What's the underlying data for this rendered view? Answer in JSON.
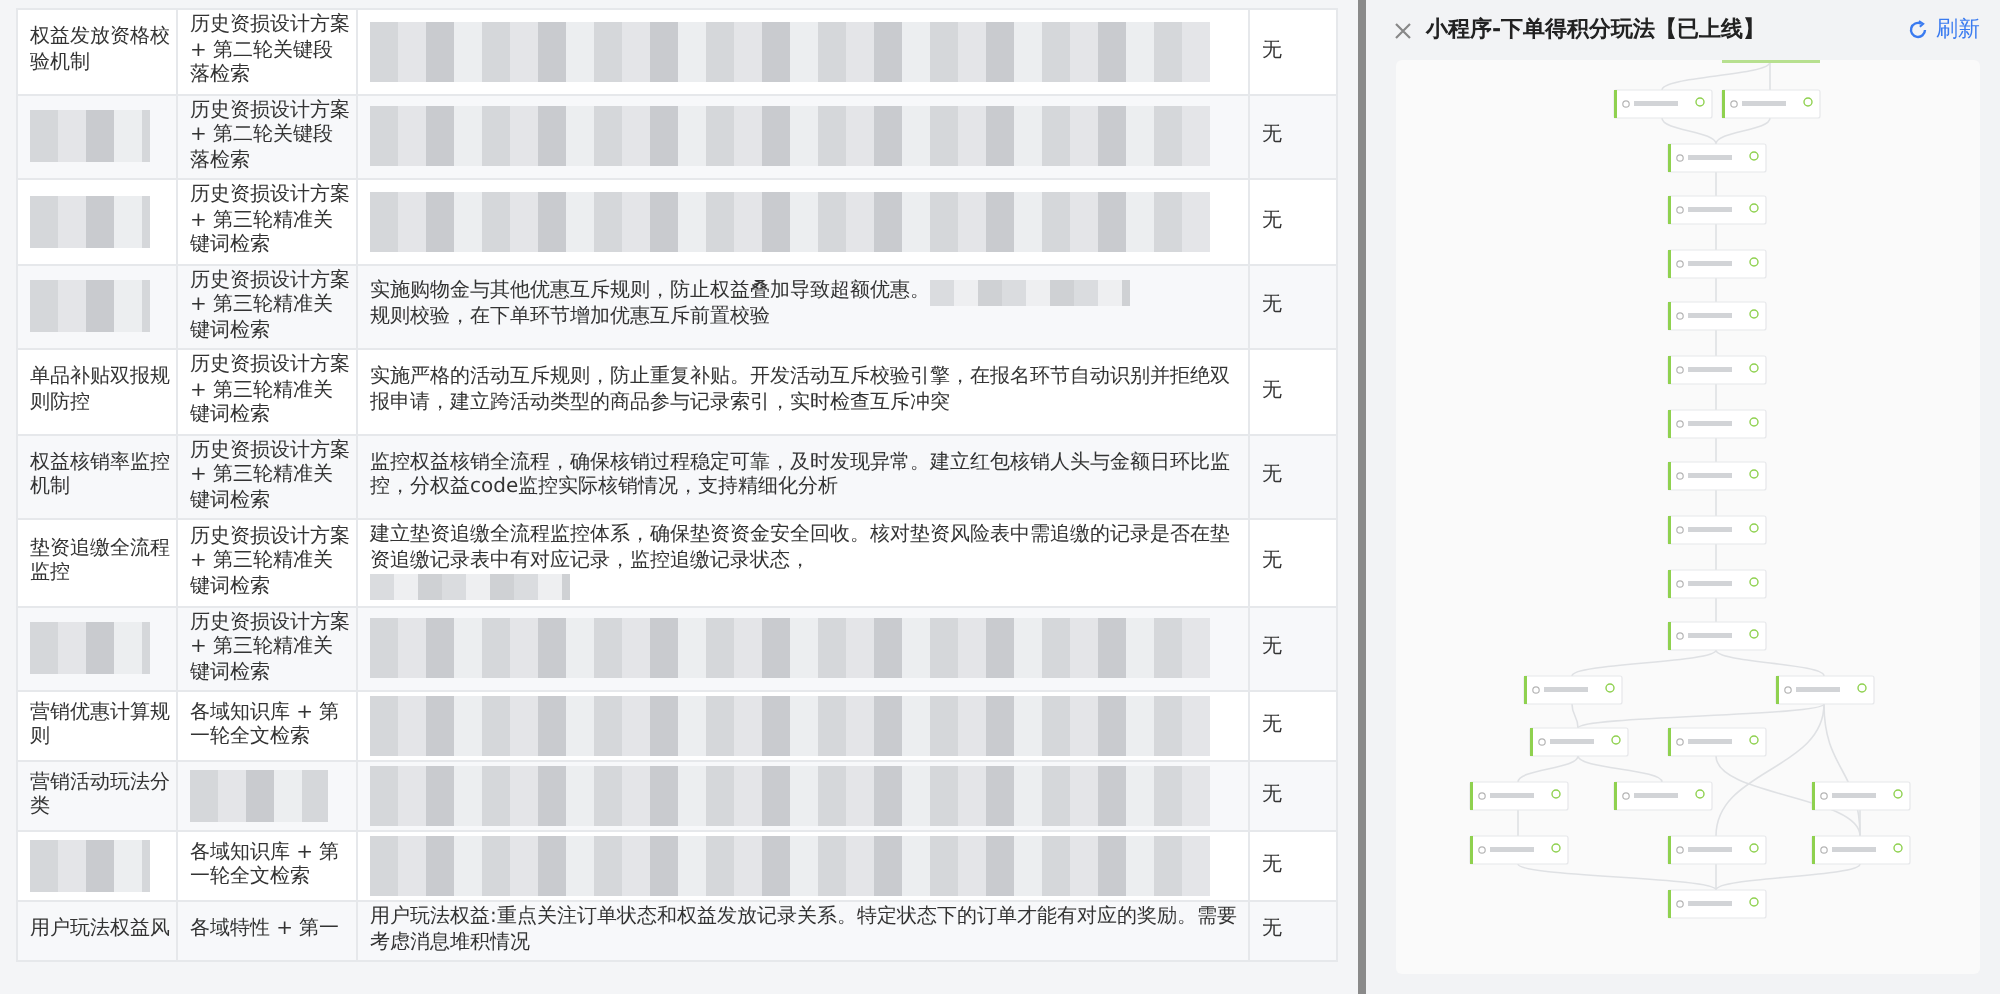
{
  "table": {
    "rows": [
      {
        "cells": [
          [
            {
              "kind": "text",
              "text": "权益发放资格校验机制"
            }
          ],
          [
            {
              "kind": "text",
              "text": "历史资损设计方案 + 第二轮关键段落检索"
            }
          ],
          [
            {
              "kind": "redacted"
            }
          ],
          [
            {
              "kind": "text",
              "text": "无"
            }
          ]
        ]
      },
      {
        "cells": [
          [
            {
              "kind": "redacted"
            }
          ],
          [
            {
              "kind": "text",
              "text": "历史资损设计方案 + 第二轮关键段落检索"
            }
          ],
          [
            {
              "kind": "redacted"
            }
          ],
          [
            {
              "kind": "text",
              "text": "无"
            }
          ]
        ]
      },
      {
        "cells": [
          [
            {
              "kind": "redacted"
            }
          ],
          [
            {
              "kind": "text",
              "text": "历史资损设计方案 + 第三轮精准关键词检索"
            }
          ],
          [
            {
              "kind": "redacted"
            }
          ],
          [
            {
              "kind": "text",
              "text": "无"
            }
          ]
        ]
      },
      {
        "cells": [
          [
            {
              "kind": "redacted"
            }
          ],
          [
            {
              "kind": "text",
              "text": "历史资损设计方案 + 第三轮精准关键词检索"
            }
          ],
          [
            {
              "kind": "text",
              "text": "实施购物金与其他优惠互斥规则，防止权益叠加导致超额优惠。"
            },
            {
              "kind": "redacted"
            },
            {
              "kind": "text",
              "text": "规则校验，在下单环节增加优惠互斥前置校验"
            }
          ],
          [
            {
              "kind": "text",
              "text": "无"
            }
          ]
        ]
      },
      {
        "cells": [
          [
            {
              "kind": "text",
              "text": "单品补贴双报规则防控"
            }
          ],
          [
            {
              "kind": "text",
              "text": "历史资损设计方案 + 第三轮精准关键词检索"
            }
          ],
          [
            {
              "kind": "text",
              "text": "实施严格的活动互斥规则，防止重复补贴。开发活动互斥校验引擎，在报名环节自动识别并拒绝双报申请，建立跨活动类型的商品参与记录索引，实时检查互斥冲突"
            }
          ],
          [
            {
              "kind": "text",
              "text": "无"
            }
          ]
        ]
      },
      {
        "cells": [
          [
            {
              "kind": "text",
              "text": "权益核销率监控机制"
            }
          ],
          [
            {
              "kind": "text",
              "text": "历史资损设计方案 + 第三轮精准关键词检索"
            }
          ],
          [
            {
              "kind": "text",
              "text": "监控权益核销全流程，确保核销过程稳定可靠，及时发现异常。建立红包核销人头与金额日环比监控，分权益code监控实际核销情况，支持精细化分析"
            }
          ],
          [
            {
              "kind": "text",
              "text": "无"
            }
          ]
        ]
      },
      {
        "cells": [
          [
            {
              "kind": "text",
              "text": "垫资追缴全流程监控"
            }
          ],
          [
            {
              "kind": "text",
              "text": "历史资损设计方案 + 第三轮精准关键词检索"
            }
          ],
          [
            {
              "kind": "text",
              "text": "建立垫资追缴全流程监控体系，确保垫资资金安全回收。核对垫资风险表中需追缴的记录是否在垫资追缴记录表中有对应记录，监控追缴记录状态，"
            },
            {
              "kind": "redacted"
            }
          ],
          [
            {
              "kind": "text",
              "text": "无"
            }
          ]
        ]
      },
      {
        "cells": [
          [
            {
              "kind": "redacted"
            }
          ],
          [
            {
              "kind": "text",
              "text": "历史资损设计方案 + 第三轮精准关键词检索"
            }
          ],
          [
            {
              "kind": "redacted"
            }
          ],
          [
            {
              "kind": "text",
              "text": "无"
            }
          ]
        ]
      },
      {
        "cells": [
          [
            {
              "kind": "text",
              "text": "营销优惠计算规则"
            }
          ],
          [
            {
              "kind": "text",
              "text": "各域知识库 + 第一轮全文检索"
            }
          ],
          [
            {
              "kind": "redacted"
            }
          ],
          [
            {
              "kind": "text",
              "text": "无"
            }
          ]
        ]
      },
      {
        "cells": [
          [
            {
              "kind": "text",
              "text": "营销活动玩法分类"
            }
          ],
          [
            {
              "kind": "redacted"
            }
          ],
          [
            {
              "kind": "redacted"
            }
          ],
          [
            {
              "kind": "text",
              "text": "无"
            }
          ]
        ]
      },
      {
        "cells": [
          [
            {
              "kind": "redacted"
            }
          ],
          [
            {
              "kind": "text",
              "text": "各域知识库 + 第一轮全文检索"
            }
          ],
          [
            {
              "kind": "redacted"
            }
          ],
          [
            {
              "kind": "text",
              "text": "无"
            }
          ]
        ]
      },
      {
        "cells": [
          [
            {
              "kind": "text",
              "text": "用户玩法权益风"
            }
          ],
          [
            {
              "kind": "text",
              "text": "各域特性 + 第一"
            }
          ],
          [
            {
              "kind": "text",
              "text": "用户玩法权益:重点关注订单状态和权益发放记录关系。特定状态下的订单才能有对应的奖励。需要考虑消息堆积情况"
            }
          ],
          [
            {
              "kind": "text",
              "text": "无"
            }
          ]
        ]
      }
    ]
  },
  "panel": {
    "title": "小程序-下单得积分玩法【已上线】",
    "refresh_label": "刷新"
  }
}
